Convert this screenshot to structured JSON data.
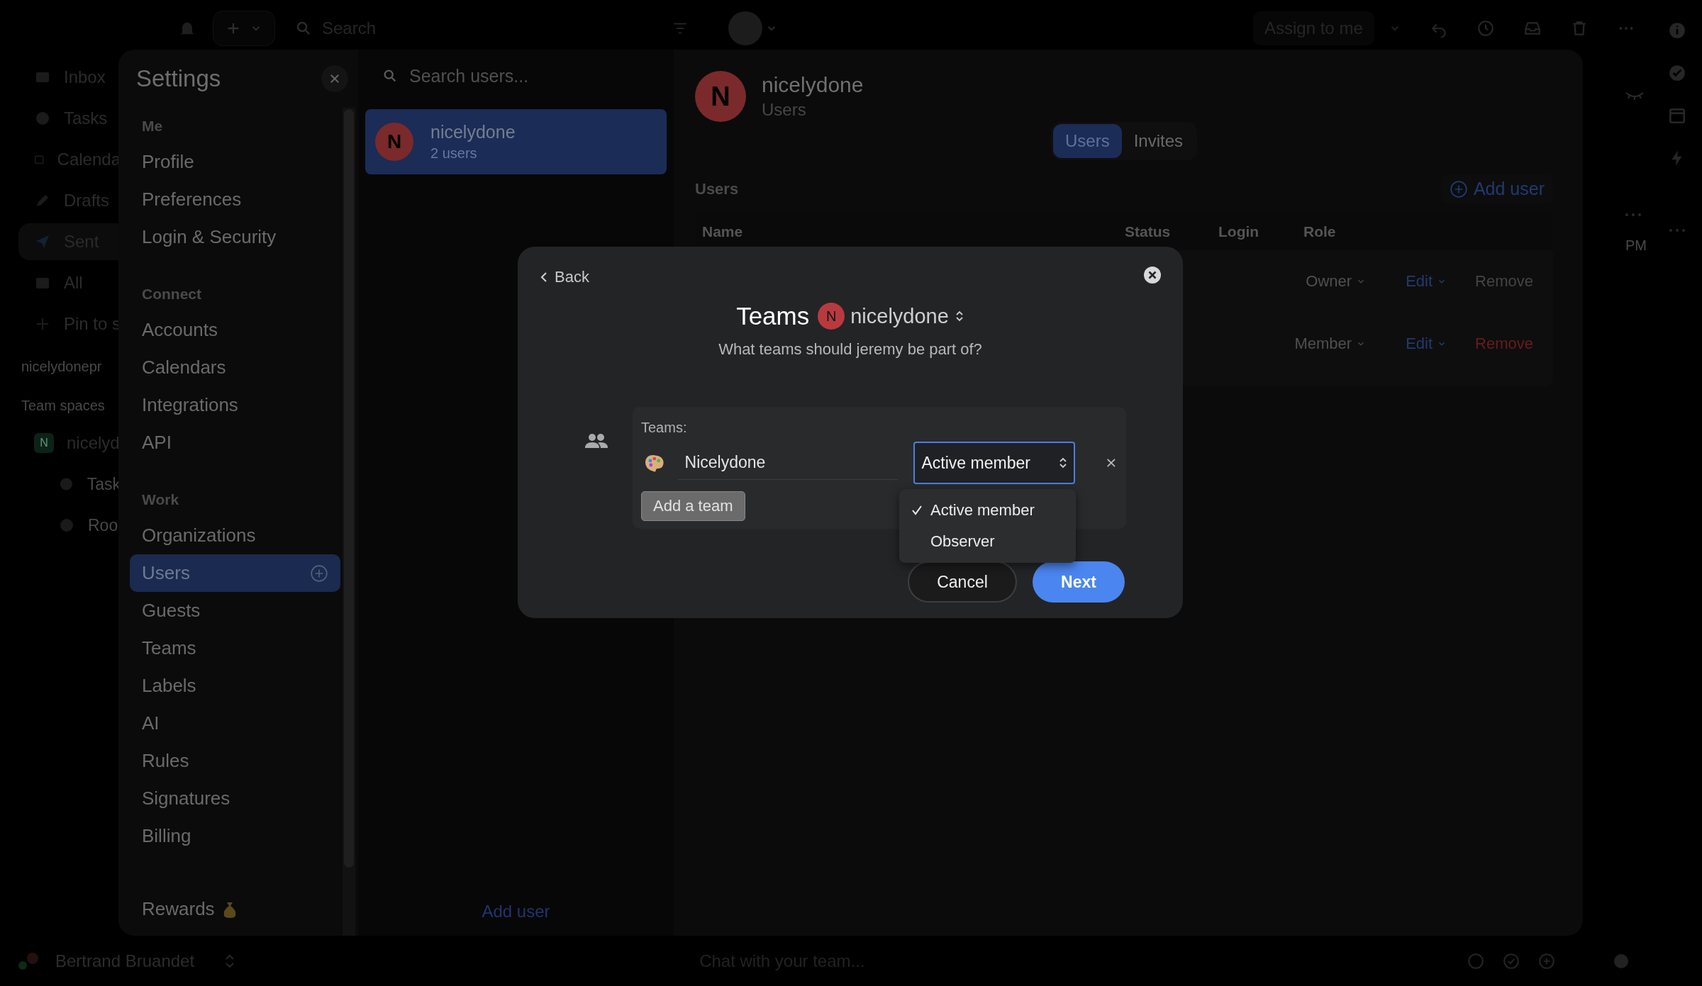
{
  "top_bar": {
    "search_placeholder": "Search",
    "assign_button": "Assign to me"
  },
  "app_sidebar": {
    "items": [
      {
        "label": "Inbox",
        "selected": false
      },
      {
        "label": "Tasks",
        "selected": false
      },
      {
        "label": "Calenda",
        "selected": false
      },
      {
        "label": "Drafts",
        "selected": false
      },
      {
        "label": "Sent",
        "selected": true
      },
      {
        "label": "All",
        "selected": false
      },
      {
        "label": "Pin to s",
        "selected": false
      }
    ],
    "workspace": "nicelydonepr",
    "section": "Team spaces",
    "team": {
      "initial": "N",
      "name": "nicelyd",
      "children": [
        {
          "label": "Task"
        },
        {
          "label": "Roo"
        }
      ]
    }
  },
  "settings": {
    "title": "Settings",
    "sections": [
      {
        "label": "Me",
        "items": [
          {
            "label": "Profile",
            "selected": false
          },
          {
            "label": "Preferences",
            "selected": false
          },
          {
            "label": "Login & Security",
            "selected": false
          }
        ]
      },
      {
        "label": "Connect",
        "items": [
          {
            "label": "Accounts",
            "selected": false
          },
          {
            "label": "Calendars",
            "selected": false
          },
          {
            "label": "Integrations",
            "selected": false
          },
          {
            "label": "API",
            "selected": false
          }
        ]
      },
      {
        "label": "Work",
        "items": [
          {
            "label": "Organizations",
            "selected": false
          },
          {
            "label": "Users",
            "selected": true
          },
          {
            "label": "Guests",
            "selected": false
          },
          {
            "label": "Teams",
            "selected": false
          },
          {
            "label": "Labels",
            "selected": false
          },
          {
            "label": "AI",
            "selected": false
          },
          {
            "label": "Rules",
            "selected": false
          },
          {
            "label": "Signatures",
            "selected": false
          },
          {
            "label": "Billing",
            "selected": false
          }
        ]
      }
    ],
    "rewards": "Rewards"
  },
  "users_list": {
    "search_placeholder": "Search users...",
    "items": [
      {
        "initial": "N",
        "name": "nicelydone",
        "count": "2 users",
        "selected": true
      }
    ],
    "add_user": "Add user"
  },
  "detail": {
    "initial": "N",
    "title": "nicelydone",
    "subtitle": "Users",
    "tabs": [
      {
        "label": "Users",
        "selected": true
      },
      {
        "label": "Invites",
        "selected": false
      }
    ],
    "section": "Users",
    "add_user": "Add user",
    "columns": [
      "Name",
      "Status",
      "Login",
      "Role"
    ],
    "rows": [
      {
        "role": "Owner",
        "edit": "Edit",
        "remove": "Remove",
        "remove_danger": false
      },
      {
        "role": "Member",
        "edit": "Edit",
        "remove": "Remove",
        "remove_danger": true
      }
    ]
  },
  "background_list": {
    "time": "PM"
  },
  "modal": {
    "back": "Back",
    "title": "Teams",
    "org": {
      "initial": "N",
      "name": "nicelydone"
    },
    "question": "What teams should jeremy be part of?",
    "teams_label": "Teams:",
    "teams": [
      {
        "name": "Nicelydone",
        "role": "Active member"
      }
    ],
    "add_team": "Add a team",
    "role_menu": [
      {
        "label": "Active member",
        "selected": true
      },
      {
        "label": "Observer",
        "selected": false
      }
    ],
    "cancel": "Cancel",
    "next": "Next"
  },
  "bottom_bar": {
    "user": "Bertrand Bruandet",
    "chat_placeholder": "Chat with your team..."
  }
}
